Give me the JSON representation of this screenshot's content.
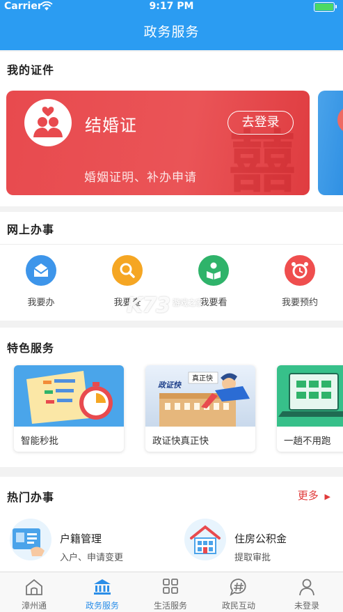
{
  "status_bar": {
    "carrier": "Carrier",
    "time": "9:17 PM"
  },
  "nav": {
    "title": "政务服务"
  },
  "certificates": {
    "title": "我的证件",
    "card": {
      "name": "结婚证",
      "login_label": "去登录",
      "description": "婚姻证明、补办申请",
      "color": "#e84a4e"
    }
  },
  "online": {
    "title": "网上办事",
    "items": [
      {
        "label": "我要办",
        "icon": "envelope-icon",
        "color": "#3d95ea"
      },
      {
        "label": "我要查",
        "icon": "search-icon",
        "color": "#f5a623"
      },
      {
        "label": "我要看",
        "icon": "reader-icon",
        "color": "#2fb36a"
      },
      {
        "label": "我要预约",
        "icon": "alarm-clock-icon",
        "color": "#ef4e4e"
      }
    ]
  },
  "watermark": {
    "brand": "K73",
    "site": "游戏之家"
  },
  "featured": {
    "title": "特色服务",
    "items": [
      {
        "label": "智能秒批",
        "icon": "checklist-timer-illustration"
      },
      {
        "label": "政证快真正快",
        "icon": "hero-building-illustration",
        "banner": "政证快",
        "sign": "真正快"
      },
      {
        "label": "一趟不用跑",
        "icon": "laptop-illustration"
      }
    ]
  },
  "hot": {
    "title": "热门办事",
    "more_label": "更多",
    "items": [
      {
        "title": "户籍管理",
        "subtitle": "入户、申请变更",
        "icon": "id-card-icon"
      },
      {
        "title": "住房公积金",
        "subtitle": "提取审批",
        "icon": "house-icon"
      }
    ]
  },
  "tabbar": {
    "active_color": "#2b8ee8",
    "items": [
      {
        "label": "漳州通",
        "icon": "home-icon"
      },
      {
        "label": "政务服务",
        "icon": "government-icon",
        "active": true
      },
      {
        "label": "生活服务",
        "icon": "grid-icon"
      },
      {
        "label": "政民互动",
        "icon": "chat-hashtag-icon"
      },
      {
        "label": "未登录",
        "icon": "user-icon"
      }
    ]
  }
}
